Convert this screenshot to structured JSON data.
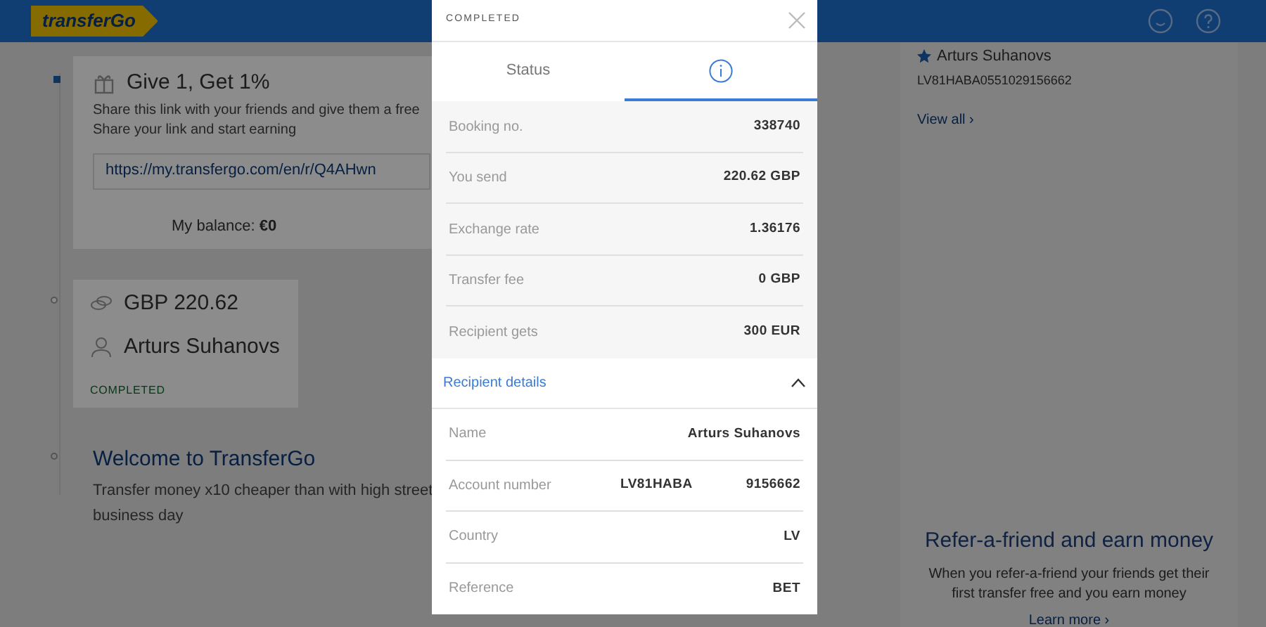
{
  "header": {
    "logo": "transferGo"
  },
  "referral": {
    "title": "Give 1, Get 1%",
    "description": [
      "Share this link with your friends and give them a free",
      "Share your link and start earning"
    ],
    "link": "https://my.transfergo.com/en/r/Q4AHwn",
    "balance": "My balance: **€0**"
  },
  "transfer": {
    "amount": "GBP 220.62",
    "recipient": "Arturs Suhanovs",
    "status": "COMPLETED"
  },
  "welcome": {
    "title": "Welcome to TransferGo",
    "text": [
      "Transfer money x10 cheaper than with high street",
      "business day"
    ]
  },
  "sidebar": {
    "recipient": {
      "name": "Arturs Suhanovs",
      "account": "LV81HABA0551029156662"
    },
    "view_all": "View all ›",
    "promo": {
      "title": "Refer-a-friend and earn money",
      "text": "When you refer-a-friend your friends get their first transfer free and you earn money",
      "link": "Learn more ›"
    }
  },
  "modal": {
    "status": "COMPLETED",
    "tabs": [
      {
        "kind": "text",
        "label": "Status",
        "selected": false
      },
      {
        "kind": "info",
        "selected": true
      }
    ],
    "summary": [
      {
        "label": "Booking no.",
        "values": [
          "338740"
        ]
      },
      {
        "label": "You send",
        "values": [
          "220.62 GBP"
        ]
      },
      {
        "label": "Exchange rate",
        "values": [
          "1.36176"
        ]
      },
      {
        "label": "Transfer fee",
        "values": [
          "0 GBP"
        ]
      },
      {
        "label": "Recipient gets",
        "values": [
          "300 EUR"
        ]
      }
    ],
    "section": {
      "title": "Recipient details",
      "expanded": true
    },
    "details": [
      {
        "label": "Name",
        "values": [
          "Arturs Suhanovs"
        ]
      },
      {
        "label": "Account number",
        "values": [
          "LV81HABA",
          "9156662"
        ]
      },
      {
        "label": "Country",
        "values": [
          "LV"
        ]
      },
      {
        "label": "Reference",
        "values": [
          "BET"
        ]
      }
    ]
  }
}
